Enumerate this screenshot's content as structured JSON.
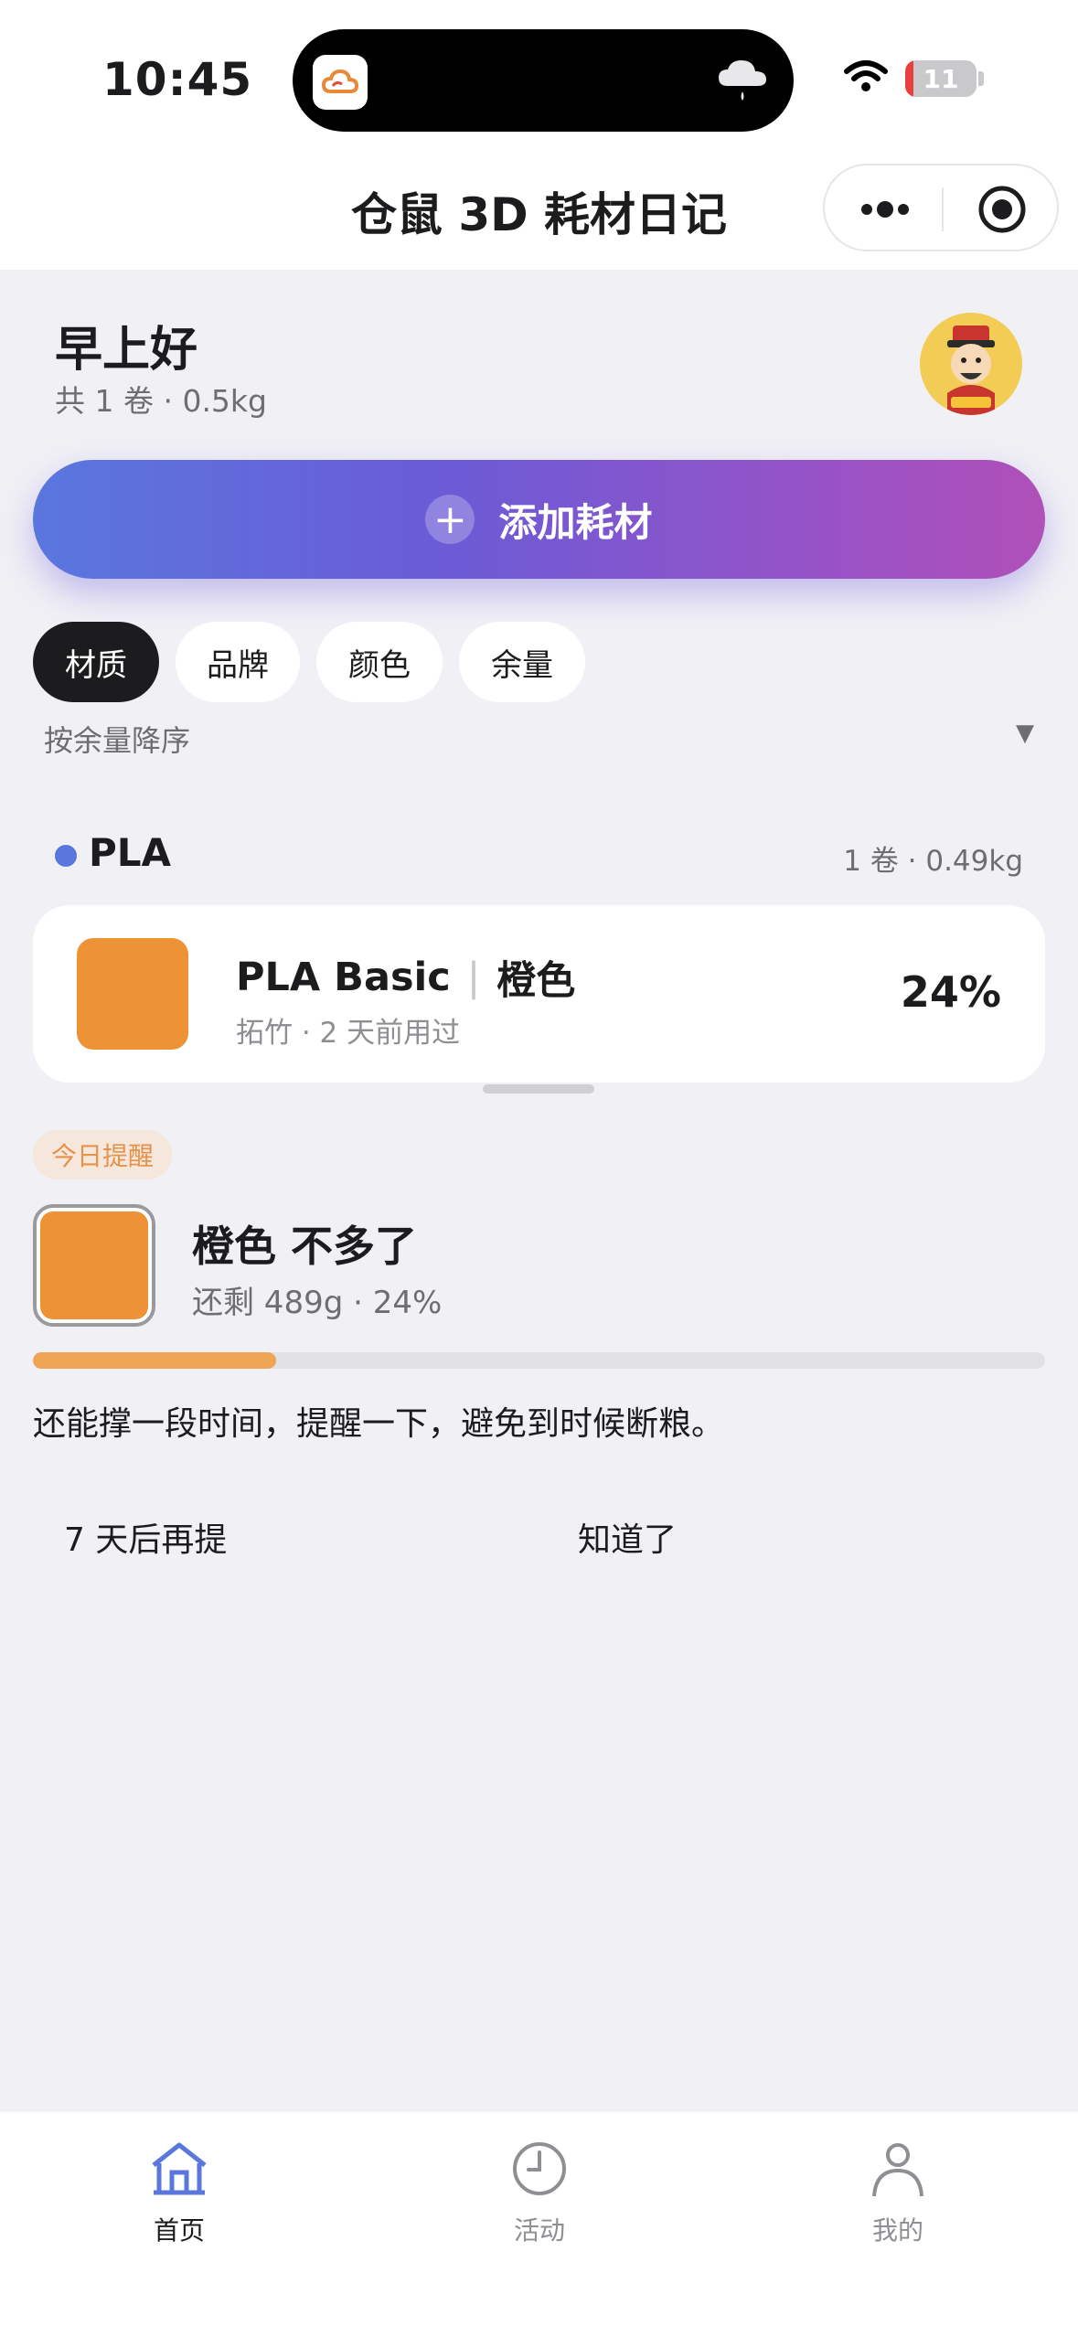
{
  "status_bar": {
    "time": "10:45",
    "battery": "11",
    "battery_level": 0.11
  },
  "nav": {
    "title": "仓鼠 3D 耗材日记"
  },
  "header": {
    "greeting": "早上好",
    "summary": "共 1 卷 · 0.5kg"
  },
  "add_button": {
    "label": "添加耗材"
  },
  "filters": {
    "chips": [
      "材质",
      "品牌",
      "颜色",
      "余量"
    ],
    "active": "材质",
    "sort_label": "按余量降序",
    "sort_caret": "▼"
  },
  "group": {
    "name": "PLA",
    "meta": "1 卷 · 0.49kg",
    "dot_color": "#5a77de"
  },
  "spools": [
    {
      "name": "PLA Basic",
      "color_name": "橙色",
      "brand_time": "拓竹 · 2 天前用过",
      "percent": "24%",
      "swatch_color": "#ed9335"
    }
  ],
  "reminder": {
    "badge": "今日提醒",
    "title": "橙色 不多了",
    "subtitle": "还剩 489g · 24%",
    "progress": 0.24,
    "message": "还能撑一段时间，提醒一下，避免到时候断粮。",
    "snooze_label": "7 天后再提",
    "ack_label": "知道了",
    "swatch_color": "#ed9335"
  },
  "tabbar": {
    "tabs": [
      {
        "label": "首页",
        "icon": "home-icon",
        "active": true
      },
      {
        "label": "活动",
        "icon": "clock-icon",
        "active": false
      },
      {
        "label": "我的",
        "icon": "profile-icon",
        "active": false
      }
    ]
  },
  "colors": {
    "accent": "#5a77de",
    "gradient_end": "#b050b8",
    "warning": "#eda455"
  }
}
